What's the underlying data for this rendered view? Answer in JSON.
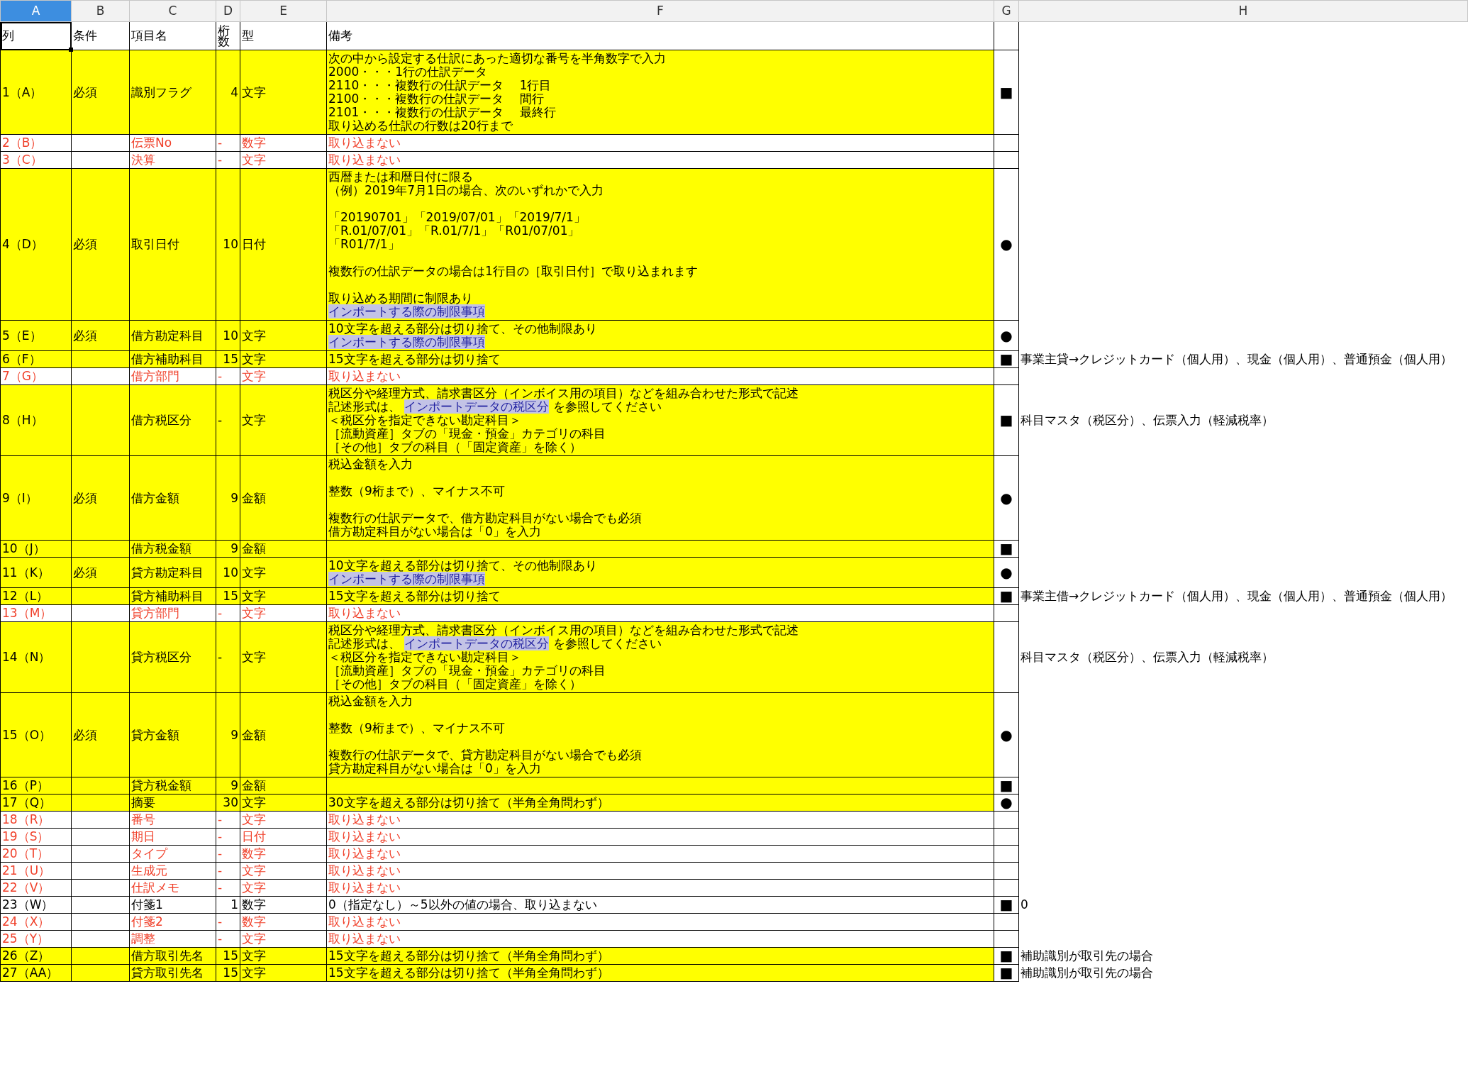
{
  "column_letters": [
    {
      "label": "A",
      "selected": true
    },
    {
      "label": "B",
      "selected": false
    },
    {
      "label": "C",
      "selected": false
    },
    {
      "label": "D",
      "selected": false
    },
    {
      "label": "E",
      "selected": false
    },
    {
      "label": "F",
      "selected": false
    },
    {
      "label": "G",
      "selected": false
    },
    {
      "label": "H",
      "selected": false
    }
  ],
  "header": [
    {
      "text": "列",
      "selected": true
    },
    {
      "text": "条件",
      "selected": false
    },
    {
      "text": "項目名",
      "selected": false
    },
    {
      "text": "桁数",
      "selected": false
    },
    {
      "text": "型",
      "selected": false
    },
    {
      "text": "備考",
      "selected": false
    }
  ],
  "rows": [
    {
      "column": "1（A）",
      "condition": "必須",
      "item": "識別フラグ",
      "digits": "4",
      "type": "文字",
      "highlighted": true,
      "excluded": false,
      "mark": "■",
      "remarks": [
        {
          "kind": "text",
          "text": "次の中から設定する仕訳にあった適切な番号を半角数字で入力"
        },
        {
          "kind": "text",
          "text": "2000・・・1行の仕訳データ"
        },
        {
          "kind": "text",
          "text": "2110・・・複数行の仕訳データ　 1行目"
        },
        {
          "kind": "text",
          "text": "2100・・・複数行の仕訳データ　 間行"
        },
        {
          "kind": "text",
          "text": "2101・・・複数行の仕訳データ　 最終行"
        },
        {
          "kind": "text",
          "text": "取り込める仕訳の行数は20行まで"
        }
      ]
    },
    {
      "column": "2（B）",
      "item": "伝票No",
      "digits": "-",
      "type": "数字",
      "highlighted": false,
      "excluded": true,
      "remarks": [
        {
          "kind": "text",
          "text": "取り込まない"
        }
      ]
    },
    {
      "column": "3（C）",
      "item": "決算",
      "digits": "-",
      "type": "文字",
      "highlighted": false,
      "excluded": true,
      "remarks": [
        {
          "kind": "text",
          "text": "取り込まない"
        }
      ]
    },
    {
      "column": "4（D）",
      "condition": "必須",
      "item": "取引日付",
      "digits": "10",
      "type": "日付",
      "highlighted": true,
      "excluded": false,
      "mark": "●",
      "remarks": [
        {
          "kind": "text",
          "text": "西暦または和暦日付に限る"
        },
        {
          "kind": "text",
          "text": "（例）2019年7月1日の場合、次のいずれかで入力"
        },
        {
          "kind": "gap"
        },
        {
          "kind": "text",
          "text": "「20190701」「2019/07/01」「2019/7/1」"
        },
        {
          "kind": "text",
          "text": "「R.01/07/01」「R.01/7/1」「R01/07/01」"
        },
        {
          "kind": "text",
          "text": "「R01/7/1」"
        },
        {
          "kind": "gap"
        },
        {
          "kind": "text",
          "text": "複数行の仕訳データの場合は1行目の［取引日付］で取り込まれます"
        },
        {
          "kind": "gap"
        },
        {
          "kind": "text",
          "text": "取り込める期間に制限あり"
        },
        {
          "kind": "link",
          "text": "インポートする際の制限事項"
        }
      ]
    },
    {
      "column": "5（E）",
      "condition": "必須",
      "item": "借方勘定科目",
      "digits": "10",
      "type": "文字",
      "highlighted": true,
      "excluded": false,
      "mark": "●",
      "remarks": [
        {
          "kind": "text",
          "text": "10文字を超える部分は切り捨て、その他制限あり"
        },
        {
          "kind": "link",
          "text": "インポートする際の制限事項"
        }
      ]
    },
    {
      "column": "6（F）",
      "item": "借方補助科目",
      "digits": "15",
      "type": "文字",
      "highlighted": true,
      "excluded": false,
      "mark": "■",
      "remarks": [
        {
          "kind": "text",
          "text": "15文字を超える部分は切り捨て"
        }
      ],
      "note": "事業主貸→クレジットカード（個人用）、現金（個人用）、普通預金（個人用）"
    },
    {
      "column": "7（G）",
      "item": "借方部門",
      "digits": "-",
      "type": "文字",
      "highlighted": false,
      "excluded": true,
      "remarks": [
        {
          "kind": "text",
          "text": "取り込まない"
        }
      ]
    },
    {
      "column": "8（H）",
      "item": "借方税区分",
      "digits": "-",
      "type": "文字",
      "highlighted": true,
      "excluded": false,
      "mark": "■",
      "remarks": [
        {
          "kind": "text",
          "text": "税区分や経理方式、請求書区分（インボイス用の項目）などを組み合わせた形式で記述"
        },
        {
          "kind": "mixed",
          "parts": [
            {
              "text": "記述形式は、 ",
              "link": false
            },
            {
              "text": "インポートデータの税区分",
              "link": true
            },
            {
              "text": " を参照してください",
              "link": false
            }
          ]
        },
        {
          "kind": "text",
          "text": "＜税区分を指定できない勘定科目＞"
        },
        {
          "kind": "text",
          "text": "［流動資産］タブの「現金・預金」カテゴリの科目"
        },
        {
          "kind": "text",
          "text": "［その他］タブの科目（「固定資産」を除く）"
        }
      ],
      "note": "科目マスタ（税区分）、伝票入力（軽減税率）"
    },
    {
      "column": "9（I）",
      "condition": "必須",
      "item": "借方金額",
      "digits": "9",
      "type": "金額",
      "highlighted": true,
      "excluded": false,
      "mark": "●",
      "remarks": [
        {
          "kind": "text",
          "text": "税込金額を入力"
        },
        {
          "kind": "gap"
        },
        {
          "kind": "text",
          "text": "整数（9桁まで）、マイナス不可"
        },
        {
          "kind": "gap"
        },
        {
          "kind": "text",
          "text": "複数行の仕訳データで、借方勘定科目がない場合でも必須"
        },
        {
          "kind": "text",
          "text": "借方勘定科目がない場合は「0」を入力"
        }
      ]
    },
    {
      "column": "10（J）",
      "item": "借方税金額",
      "digits": "9",
      "type": "金額",
      "highlighted": true,
      "excluded": false,
      "mark": "■"
    },
    {
      "column": "11（K）",
      "condition": "必須",
      "item": "貸方勘定科目",
      "digits": "10",
      "type": "文字",
      "highlighted": true,
      "excluded": false,
      "mark": "●",
      "remarks": [
        {
          "kind": "text",
          "text": "10文字を超える部分は切り捨て、その他制限あり"
        },
        {
          "kind": "link",
          "text": "インポートする際の制限事項"
        }
      ]
    },
    {
      "column": "12（L）",
      "item": "貸方補助科目",
      "digits": "15",
      "type": "文字",
      "highlighted": true,
      "excluded": false,
      "mark": "■",
      "remarks": [
        {
          "kind": "text",
          "text": "15文字を超える部分は切り捨て"
        }
      ],
      "note": "事業主借→クレジットカード（個人用）、現金（個人用）、普通預金（個人用）"
    },
    {
      "column": "13（M）",
      "item": "貸方部門",
      "digits": "-",
      "type": "文字",
      "highlighted": false,
      "excluded": true,
      "remarks": [
        {
          "kind": "text",
          "text": "取り込まない"
        }
      ]
    },
    {
      "column": "14（N）",
      "item": "貸方税区分",
      "digits": "-",
      "type": "文字",
      "highlighted": true,
      "excluded": false,
      "remarks": [
        {
          "kind": "text",
          "text": "税区分や経理方式、請求書区分（インボイス用の項目）などを組み合わせた形式で記述"
        },
        {
          "kind": "mixed",
          "parts": [
            {
              "text": "記述形式は、 ",
              "link": false
            },
            {
              "text": "インポートデータの税区分",
              "link": true
            },
            {
              "text": " を参照してください",
              "link": false
            }
          ]
        },
        {
          "kind": "text",
          "text": "＜税区分を指定できない勘定科目＞"
        },
        {
          "kind": "text",
          "text": "［流動資産］タブの「現金・預金」カテゴリの科目"
        },
        {
          "kind": "text",
          "text": "［その他］タブの科目（「固定資産」を除く）"
        }
      ],
      "note": "科目マスタ（税区分）、伝票入力（軽減税率）"
    },
    {
      "column": "15（O）",
      "condition": "必須",
      "item": "貸方金額",
      "digits": "9",
      "type": "金額",
      "highlighted": true,
      "excluded": false,
      "mark": "●",
      "remarks": [
        {
          "kind": "text",
          "text": "税込金額を入力"
        },
        {
          "kind": "gap"
        },
        {
          "kind": "text",
          "text": "整数（9桁まで）、マイナス不可"
        },
        {
          "kind": "gap"
        },
        {
          "kind": "text",
          "text": "複数行の仕訳データで、貸方勘定科目がない場合でも必須"
        },
        {
          "kind": "text",
          "text": "貸方勘定科目がない場合は「0」を入力"
        }
      ]
    },
    {
      "column": "16（P）",
      "item": "貸方税金額",
      "digits": "9",
      "type": "金額",
      "highlighted": true,
      "excluded": false,
      "mark": "■"
    },
    {
      "column": "17（Q）",
      "item": "摘要",
      "digits": "30",
      "type": "文字",
      "highlighted": true,
      "excluded": false,
      "mark": "●",
      "remarks": [
        {
          "kind": "text",
          "text": "30文字を超える部分は切り捨て（半角全角問わず）"
        }
      ]
    },
    {
      "column": "18（R）",
      "item": "番号",
      "digits": "-",
      "type": "文字",
      "highlighted": false,
      "excluded": true,
      "remarks": [
        {
          "kind": "text",
          "text": "取り込まない"
        }
      ]
    },
    {
      "column": "19（S）",
      "item": "期日",
      "digits": "-",
      "type": "日付",
      "highlighted": false,
      "excluded": true,
      "remarks": [
        {
          "kind": "text",
          "text": "取り込まない"
        }
      ]
    },
    {
      "column": "20（T）",
      "item": "タイプ",
      "digits": "-",
      "type": "数字",
      "highlighted": false,
      "excluded": true,
      "remarks": [
        {
          "kind": "text",
          "text": "取り込まない"
        }
      ]
    },
    {
      "column": "21（U）",
      "item": "生成元",
      "digits": "-",
      "type": "文字",
      "highlighted": false,
      "excluded": true,
      "remarks": [
        {
          "kind": "text",
          "text": "取り込まない"
        }
      ]
    },
    {
      "column": "22（V）",
      "item": "仕訳メモ",
      "digits": "-",
      "type": "文字",
      "highlighted": false,
      "excluded": true,
      "remarks": [
        {
          "kind": "text",
          "text": "取り込まない"
        }
      ]
    },
    {
      "column": "23（W）",
      "item": "付箋1",
      "digits": "1",
      "type": "数字",
      "highlighted": false,
      "excluded": false,
      "mark": "■",
      "remarks": [
        {
          "kind": "text",
          "text": "0（指定なし）～5以外の値の場合、取り込まない"
        }
      ],
      "note": "0"
    },
    {
      "column": "24（X）",
      "item": "付箋2",
      "digits": "-",
      "type": "数字",
      "highlighted": false,
      "excluded": true,
      "remarks": [
        {
          "kind": "text",
          "text": "取り込まない"
        }
      ]
    },
    {
      "column": "25（Y）",
      "item": "調整",
      "digits": "-",
      "type": "文字",
      "highlighted": false,
      "excluded": true,
      "remarks": [
        {
          "kind": "text",
          "text": "取り込まない"
        }
      ]
    },
    {
      "column": "26（Z）",
      "item": "借方取引先名",
      "digits": "15",
      "type": "文字",
      "highlighted": true,
      "excluded": false,
      "mark": "■",
      "remarks": [
        {
          "kind": "text",
          "text": "15文字を超える部分は切り捨て（半角全角問わず）"
        }
      ],
      "note": "補助識別が取引先の場合"
    },
    {
      "column": "27（AA）",
      "item": "貸方取引先名",
      "digits": "15",
      "type": "文字",
      "highlighted": true,
      "excluded": false,
      "mark": "■",
      "remarks": [
        {
          "kind": "text",
          "text": "15文字を超える部分は切り捨て（半角全角問わず）"
        }
      ],
      "note": "補助識別が取引先の場合"
    }
  ]
}
